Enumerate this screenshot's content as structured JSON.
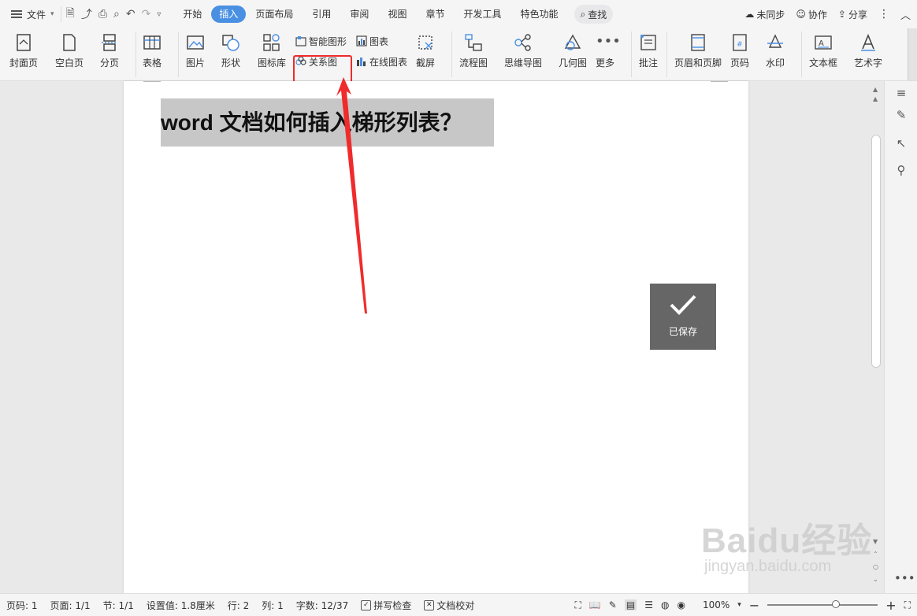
{
  "menubar": {
    "file_label": "文件",
    "tabs": [
      "开始",
      "插入",
      "页面布局",
      "引用",
      "审阅",
      "视图",
      "章节",
      "开发工具",
      "特色功能"
    ],
    "active_tab": "插入",
    "search_label": "查找",
    "sync_label": "未同步",
    "collab_label": "协作",
    "share_label": "分享"
  },
  "ribbon": {
    "cover": "封面页",
    "blank_page": "空白页",
    "page_break": "分页",
    "table": "表格",
    "picture": "图片",
    "shape": "形状",
    "icon_lib": "图标库",
    "smart_art": "智能图形",
    "relation": "关系图",
    "chart": "图表",
    "online_chart": "在线图表",
    "screenshot": "截屏",
    "flowchart": "流程图",
    "mindmap": "思维导图",
    "geometry": "几何图",
    "more": "更多",
    "comment": "批注",
    "header_footer": "页眉和页脚",
    "page_number": "页码",
    "watermark": "水印",
    "textbox": "文本框",
    "wordart": "艺术字"
  },
  "document": {
    "title": "word 文档如何插入梯形列表？"
  },
  "toast": {
    "label": "已保存"
  },
  "status": {
    "page_num": "页码: 1",
    "pages": "页面: 1/1",
    "section": "节: 1/1",
    "setting": "设置值: 1.8厘米",
    "row": "行: 2",
    "col": "列: 1",
    "words": "字数: 12/37",
    "spell_check": "拼写检查",
    "doc_proof": "文档校对",
    "zoom": "100%",
    "zoom_fraction": 0.62
  },
  "watermark": {
    "brand": "Baidu经验",
    "url": "jingyan.baidu.com"
  },
  "colors": {
    "accent": "#4a90e2",
    "highlight": "#f02b2b",
    "toast_bg": "#666666"
  }
}
